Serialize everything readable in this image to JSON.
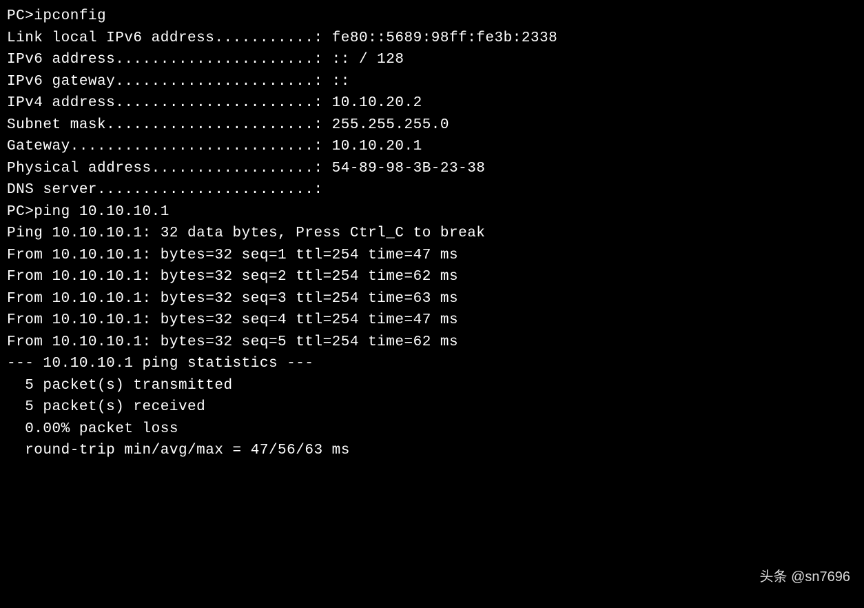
{
  "terminal": {
    "lines": [
      "PC>ipconfig",
      "",
      "Link local IPv6 address...........: fe80::5689:98ff:fe3b:2338",
      "IPv6 address......................: :: / 128",
      "IPv6 gateway......................: ::",
      "IPv4 address......................: 10.10.20.2",
      "Subnet mask.......................: 255.255.255.0",
      "Gateway...........................: 10.10.20.1",
      "Physical address..................: 54-89-98-3B-23-38",
      "DNS server........................:",
      "",
      "PC>ping 10.10.10.1",
      "",
      "Ping 10.10.10.1: 32 data bytes, Press Ctrl_C to break",
      "From 10.10.10.1: bytes=32 seq=1 ttl=254 time=47 ms",
      "From 10.10.10.1: bytes=32 seq=2 ttl=254 time=62 ms",
      "From 10.10.10.1: bytes=32 seq=3 ttl=254 time=63 ms",
      "From 10.10.10.1: bytes=32 seq=4 ttl=254 time=47 ms",
      "From 10.10.10.1: bytes=32 seq=5 ttl=254 time=62 ms",
      "",
      "--- 10.10.10.1 ping statistics ---",
      "  5 packet(s) transmitted",
      "  5 packet(s) received",
      "  0.00% packet loss",
      "  round-trip min/avg/max = 47/56/63 ms",
      ""
    ]
  },
  "watermark": "头条 @sn7696"
}
